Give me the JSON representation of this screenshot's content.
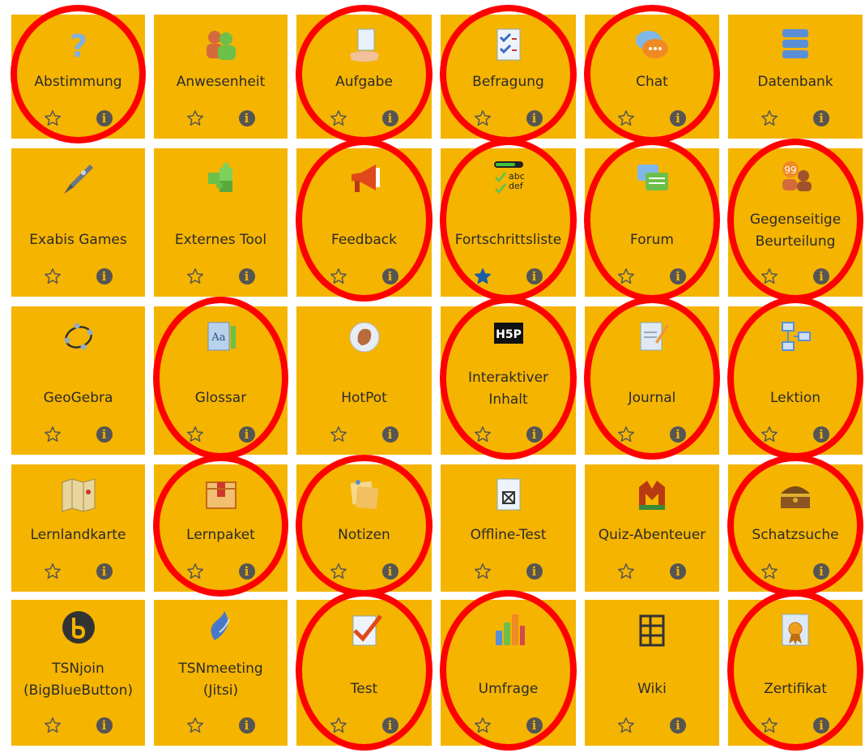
{
  "colors": {
    "tile": "#f5b400",
    "text": "#2b2b2b",
    "highlight_circle": "#ff0000",
    "info": "#555555",
    "star_active": "#1a5fa6"
  },
  "tiles": [
    {
      "label": [
        "Abstimmung"
      ],
      "icon": "question-icon",
      "starred": false,
      "circled": true
    },
    {
      "label": [
        "Anwesenheit"
      ],
      "icon": "people-icon",
      "starred": false,
      "circled": false
    },
    {
      "label": [
        "Aufgabe"
      ],
      "icon": "hand-document-icon",
      "starred": false,
      "circled": true
    },
    {
      "label": [
        "Befragung"
      ],
      "icon": "checklist-icon",
      "starred": false,
      "circled": true
    },
    {
      "label": [
        "Chat"
      ],
      "icon": "chat-bubble-icon",
      "starred": false,
      "circled": true
    },
    {
      "label": [
        "Datenbank"
      ],
      "icon": "database-icon",
      "starred": false,
      "circled": false
    },
    {
      "label": [
        "Exabis Games"
      ],
      "icon": "rocket-icon",
      "starred": false,
      "circled": false
    },
    {
      "label": [
        "Externes Tool"
      ],
      "icon": "puzzle-icon",
      "starred": false,
      "circled": false
    },
    {
      "label": [
        "Feedback"
      ],
      "icon": "megaphone-icon",
      "starred": false,
      "circled": true
    },
    {
      "label": [
        "Fortschrittsliste"
      ],
      "icon": "progress-checklist-icon",
      "starred": true,
      "circled": true
    },
    {
      "label": [
        "Forum"
      ],
      "icon": "forum-icon",
      "starred": false,
      "circled": true
    },
    {
      "label": [
        "Gegenseitige",
        "Beurteilung"
      ],
      "icon": "peer-review-icon",
      "starred": false,
      "circled": true
    },
    {
      "label": [
        "GeoGebra"
      ],
      "icon": "geogebra-icon",
      "starred": false,
      "circled": false
    },
    {
      "label": [
        "Glossar"
      ],
      "icon": "glossary-book-icon",
      "starred": false,
      "circled": true
    },
    {
      "label": [
        "HotPot"
      ],
      "icon": "hotpot-hand-icon",
      "starred": false,
      "circled": false
    },
    {
      "label": [
        "Interaktiver",
        "Inhalt"
      ],
      "icon": "h5p-icon",
      "starred": false,
      "circled": true
    },
    {
      "label": [
        "Journal"
      ],
      "icon": "journal-pencil-icon",
      "starred": false,
      "circled": true
    },
    {
      "label": [
        "Lektion"
      ],
      "icon": "lesson-flow-icon",
      "starred": false,
      "circled": true
    },
    {
      "label": [
        "Lernlandkarte"
      ],
      "icon": "map-icon",
      "starred": false,
      "circled": false
    },
    {
      "label": [
        "Lernpaket"
      ],
      "icon": "package-box-icon",
      "starred": false,
      "circled": true
    },
    {
      "label": [
        "Notizen"
      ],
      "icon": "sticky-notes-icon",
      "starred": false,
      "circled": true
    },
    {
      "label": [
        "Offline-Test"
      ],
      "icon": "offline-test-icon",
      "starred": false,
      "circled": false
    },
    {
      "label": [
        "Quiz-Abenteuer"
      ],
      "icon": "quiz-adventure-icon",
      "starred": false,
      "circled": false
    },
    {
      "label": [
        "Schatzsuche"
      ],
      "icon": "treasure-chest-icon",
      "starred": false,
      "circled": true
    },
    {
      "label": [
        "TSNjoin",
        "(BigBlueButton)"
      ],
      "icon": "bigbluebutton-icon",
      "starred": false,
      "circled": false
    },
    {
      "label": [
        "TSNmeeting",
        "(Jitsi)"
      ],
      "icon": "jitsi-icon",
      "starred": false,
      "circled": false
    },
    {
      "label": [
        "Test"
      ],
      "icon": "test-check-icon",
      "starred": false,
      "circled": true
    },
    {
      "label": [
        "Umfrage"
      ],
      "icon": "bar-chart-icon",
      "starred": false,
      "circled": true
    },
    {
      "label": [
        "Wiki"
      ],
      "icon": "wiki-icon",
      "starred": false,
      "circled": false
    },
    {
      "label": [
        "Zertifikat"
      ],
      "icon": "certificate-icon",
      "starred": false,
      "circled": true
    }
  ]
}
